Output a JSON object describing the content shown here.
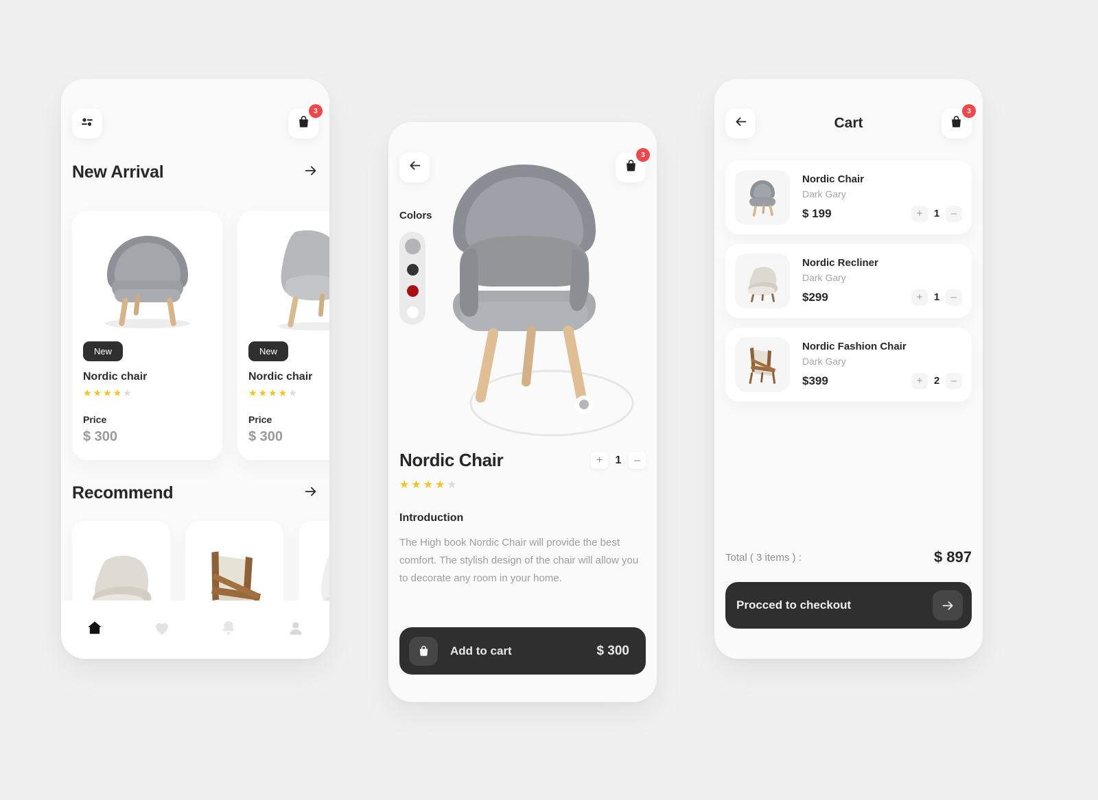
{
  "colors": {
    "page_bg": "#f0f0f0",
    "phone_bg": "#fafafa",
    "dark": "#2f2f2f",
    "badge_red": "#f0474a",
    "star_on": "#f4c51c",
    "star_off": "#dcdcdc",
    "muted": "#9d9d9d"
  },
  "home": {
    "filter_icon": "filter-sliders-icon",
    "cart_icon": "shopping-bag-icon",
    "cart_badge": "3",
    "sections": [
      {
        "title": "New Arrival",
        "arrow": "arrow-right-icon"
      },
      {
        "title": "Recommend",
        "arrow": "arrow-right-icon"
      }
    ],
    "new_arrival_products": [
      {
        "badge": "New",
        "name": "Nordic chair",
        "rating": 4,
        "rating_max": 5,
        "price_label": "Price",
        "price": "$ 300"
      },
      {
        "badge": "New",
        "name": "Nordic chair",
        "rating": 4,
        "rating_max": 5,
        "price_label": "Price",
        "price": "$ 300"
      }
    ],
    "recommend_products": [
      {
        "name": "armchair-cream"
      },
      {
        "name": "wood-frame-lounge-chair"
      },
      {
        "name": "white-chair"
      }
    ],
    "nav_items": [
      {
        "icon": "home-icon",
        "active": true
      },
      {
        "icon": "heart-icon",
        "active": false
      },
      {
        "icon": "bell-icon",
        "active": false
      },
      {
        "icon": "person-icon",
        "active": false
      }
    ]
  },
  "detail": {
    "back_icon": "arrow-left-icon",
    "cart_icon": "shopping-bag-icon",
    "cart_badge": "3",
    "colors_label": "Colors",
    "swatches": [
      {
        "name": "gray",
        "hex": "#b4b4b6",
        "selected": true
      },
      {
        "name": "black",
        "hex": "#333333",
        "selected": false
      },
      {
        "name": "red",
        "hex": "#a50f12",
        "selected": false
      },
      {
        "name": "white",
        "hex": "#ffffff",
        "selected": false
      }
    ],
    "title": "Nordic Chair",
    "quantity": "1",
    "plus": "+",
    "minus": "–",
    "rating": 4,
    "rating_max": 5,
    "intro_heading": "Introduction",
    "intro_text": "The High book Nordic Chair will provide the best comfort. The stylish design of the chair will allow you to decorate any room in your home.",
    "add_to_cart_label": "Add to cart",
    "add_to_cart_price": "$ 300",
    "add_to_cart_icon": "shopping-bag-icon"
  },
  "cart": {
    "back_icon": "arrow-left-icon",
    "title": "Cart",
    "cart_icon": "shopping-bag-icon",
    "cart_badge": "3",
    "items": [
      {
        "name": "Nordic Chair",
        "color": "Dark Gary",
        "price": "$ 199",
        "qty": "1",
        "thumb": "gray-tub-chair"
      },
      {
        "name": "Nordic Recliner",
        "color": "Dark Gary",
        "price": "$299",
        "qty": "1",
        "thumb": "cream-armchair"
      },
      {
        "name": "Nordic Fashion Chair",
        "color": "Dark Gary",
        "price": "$399",
        "qty": "2",
        "thumb": "wood-frame-lounge-chair"
      }
    ],
    "plus": "+",
    "minus": "–",
    "total_label": "Total ( 3 items ) :",
    "total_value": "$ 897",
    "checkout_label": "Procced to checkout",
    "checkout_icon": "arrow-right-icon"
  }
}
